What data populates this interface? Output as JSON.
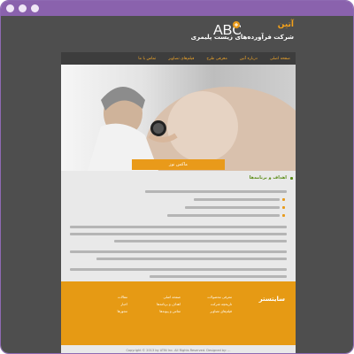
{
  "window": {
    "dots": [
      "#efe6f6",
      "#efe6f6",
      "#efe6f6"
    ]
  },
  "header": {
    "brand": "آتین",
    "tagline": "شرکت فرآورده‌های زیست پلیمری"
  },
  "nav": {
    "items": [
      {
        "label": "صفحه اصلی"
      },
      {
        "label": "درباره آتین"
      },
      {
        "label": "معرفی طرح"
      },
      {
        "label": "فیلم‌های تصاویر"
      },
      {
        "label": "تماس با ما"
      }
    ]
  },
  "hero": {
    "caption": "ماکس نوز"
  },
  "content": {
    "section_title": "اهداف و برنامه‌ها"
  },
  "footer": {
    "title": "سایتستر",
    "col1": [
      "معرفی محصولات",
      "تاریخچه شرکت",
      "فیلم‌های تصاویر"
    ],
    "col2": [
      "صفحه اصلی",
      "اهداف و برنامه‌ها",
      "تماس و پیوندها"
    ],
    "col3": [
      "مقالات",
      "اخبار",
      "مجوزها"
    ]
  },
  "copyright": "Copyright © 2013 by ATIN Inc. All Rights Reserved. Designed by: ..."
}
